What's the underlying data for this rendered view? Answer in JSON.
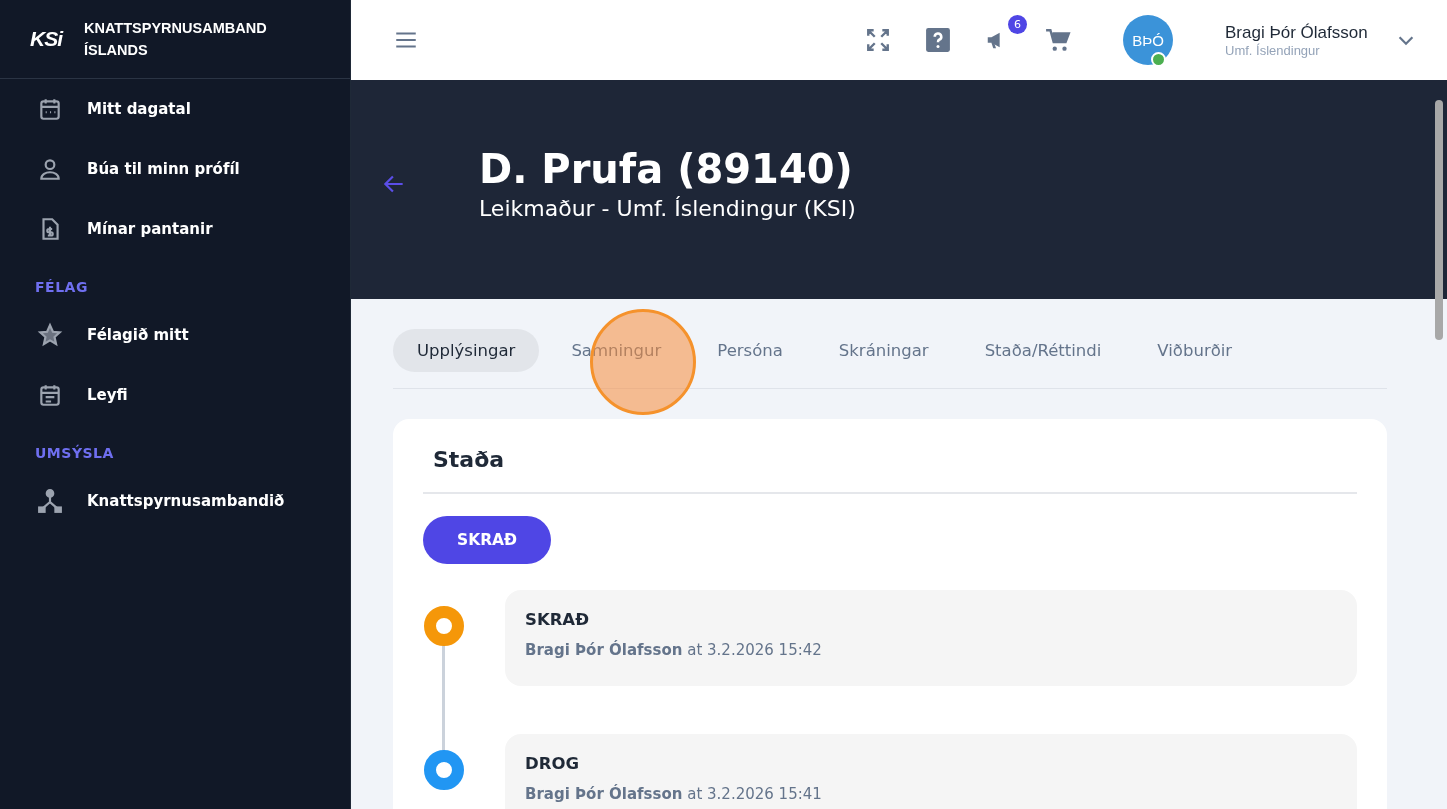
{
  "sidebar": {
    "logo": "KSi",
    "org_name": "KNATTSPYRNUSAMBAND ÍSLANDS",
    "groups": [
      {
        "items": [
          {
            "label": "Mitt dagatal"
          },
          {
            "label": "Búa til minn prófíl"
          },
          {
            "label": "Mínar pantanir"
          }
        ]
      },
      {
        "heading": "FÉLAG",
        "items": [
          {
            "label": "Félagið mitt"
          },
          {
            "label": "Leyfi"
          }
        ]
      },
      {
        "heading": "UMSÝSLA",
        "items": [
          {
            "label": "Knattspyrnusambandið"
          }
        ]
      }
    ]
  },
  "topbar": {
    "notification_count": "6",
    "user": {
      "initials": "BÞÓ",
      "online": true,
      "name": "Bragi Þór Ólafsson",
      "club": "Umf. Íslendingur"
    }
  },
  "hero": {
    "title": "D. Prufa (89140)",
    "subtitle": "Leikmaður - Umf. Íslendingur (KSI)"
  },
  "tabs": [
    {
      "label": "Upplýsingar",
      "selected": true
    },
    {
      "label": "Samningur",
      "selected": false
    },
    {
      "label": "Persóna",
      "selected": false
    },
    {
      "label": "Skráningar",
      "selected": false
    },
    {
      "label": "Staða/Réttindi",
      "selected": false
    },
    {
      "label": "Viðburðir",
      "selected": false
    }
  ],
  "click_marker": {
    "shown": true
  },
  "status_card": {
    "title": "Staða",
    "status_button": "SKRAÐ",
    "timeline": [
      {
        "status": "SKRAÐ",
        "byline": "**Bragi Þór Ólafsson** at 3.2.2026 15:42",
        "color": "#f59709"
      },
      {
        "status": "DROG",
        "byline": "**Bragi Þór Ólafsson** at 3.2.2026 15:41",
        "color": "#2196f3"
      }
    ]
  }
}
